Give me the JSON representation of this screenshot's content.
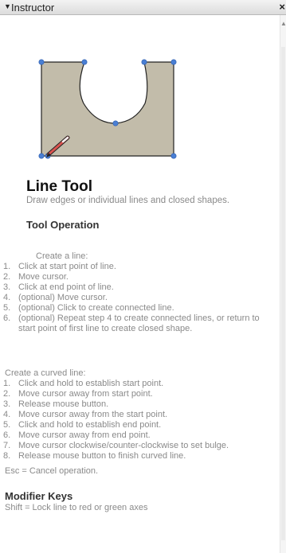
{
  "panel": {
    "title": "Instructor",
    "collapse_glyph": "▼",
    "close_glyph": "×"
  },
  "icons": {
    "pencil": "pencil-icon",
    "collapse": "collapse-triangle-icon",
    "close": "close-icon"
  },
  "colors": {
    "shape_fill": "#c2bcaa",
    "vertex": "#4a7fd4"
  },
  "tool": {
    "name": "Line Tool",
    "description": "Draw edges or individual lines and closed shapes."
  },
  "operation": {
    "heading": "Tool Operation",
    "create_line_intro": "Create a line:",
    "create_line_steps": [
      {
        "num": "1.",
        "text": "Click at start point of line."
      },
      {
        "num": "2.",
        "text": "Move cursor."
      },
      {
        "num": "3.",
        "text": "Click at end point of line."
      },
      {
        "num": "4.",
        "text": "(optional) Move cursor."
      },
      {
        "num": "5.",
        "text": "(optional) Click to create connected line."
      },
      {
        "num": "6.",
        "text": "(optional) Repeat step 4 to create connected lines, or return to start point of first line to create closed shape."
      }
    ],
    "curved_intro": "Create a curved line:",
    "curved_steps": [
      {
        "num": "1.",
        "text": "Click and hold to establish start point."
      },
      {
        "num": "2.",
        "text": "Move cursor away from start point."
      },
      {
        "num": "3.",
        "text": "Release mouse button."
      },
      {
        "num": "4.",
        "text": "Move cursor away from the start point."
      },
      {
        "num": "5.",
        "text": "Click and hold to establish end point."
      },
      {
        "num": "6.",
        "text": "Move cursor away from end point."
      },
      {
        "num": "7.",
        "text": "Move cursor clockwise/counter-clockwise to set bulge."
      },
      {
        "num": "8.",
        "text": "Release mouse button to finish curved line."
      }
    ],
    "esc_note": "Esc = Cancel operation."
  },
  "modifiers": {
    "heading": "Modifier Keys",
    "shift": "Shift = Lock line to red or green axes"
  }
}
